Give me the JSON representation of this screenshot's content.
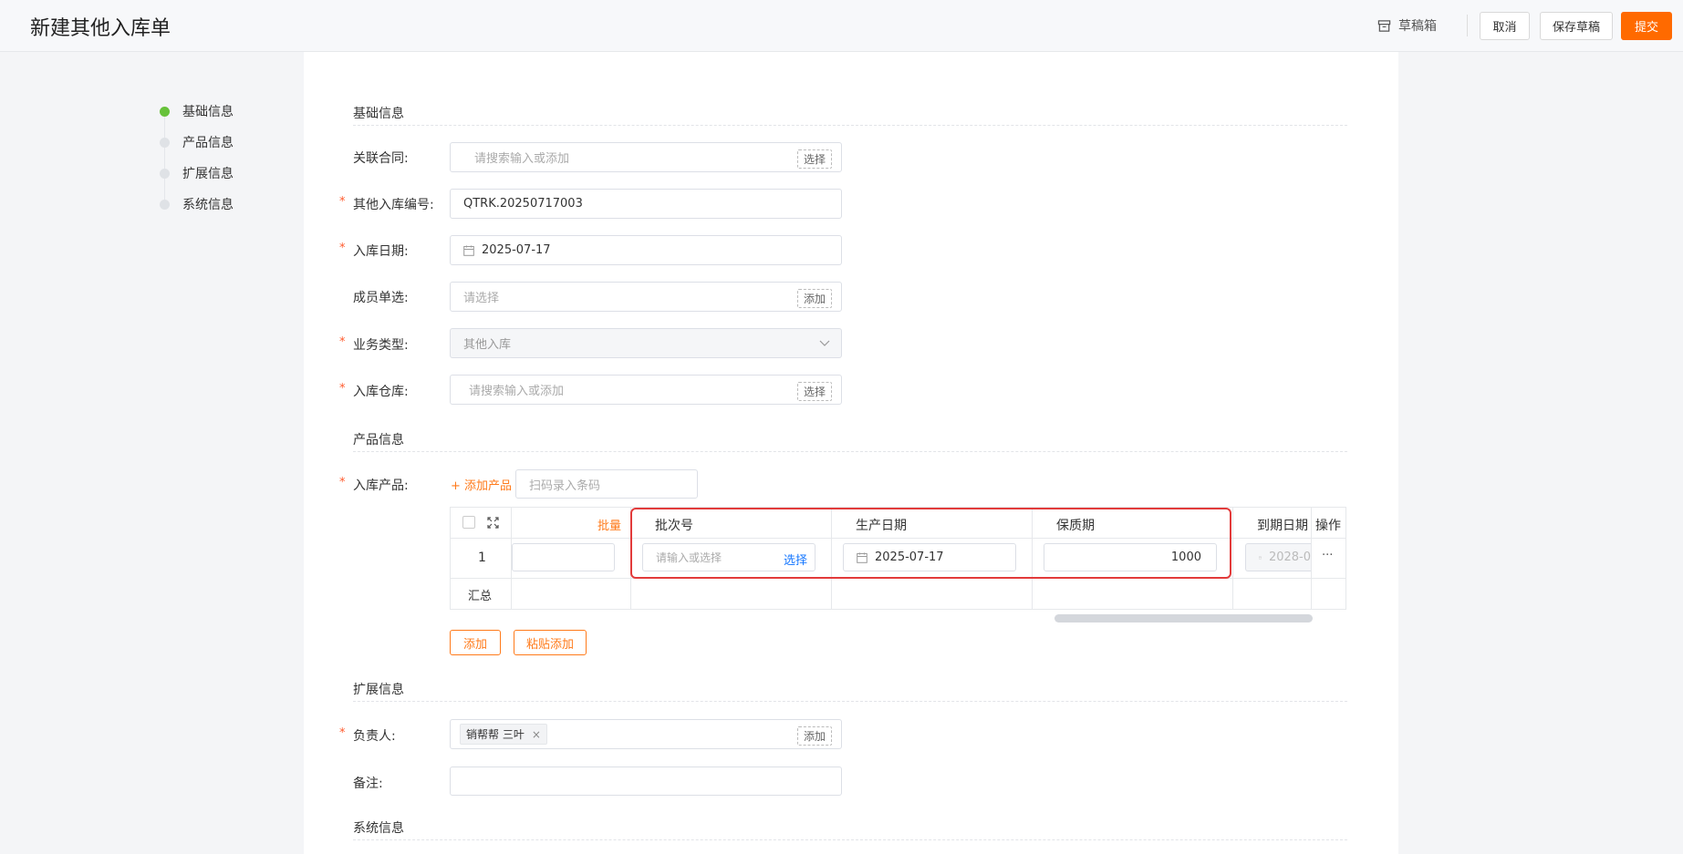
{
  "header": {
    "title": "新建其他入库单",
    "draft_label": "草稿箱",
    "cancel": "取消",
    "save_draft": "保存草稿",
    "submit": "提交"
  },
  "steps": [
    "基础信息",
    "产品信息",
    "扩展信息",
    "系统信息"
  ],
  "sections": {
    "basic": "基础信息",
    "product": "产品信息",
    "extend": "扩展信息",
    "system": "系统信息"
  },
  "form": {
    "contract": {
      "label": "关联合同:",
      "placeholder": "请搜索输入或添加",
      "action": "选择"
    },
    "code": {
      "label": "其他入库编号:",
      "value": "QTRK.20250717003"
    },
    "date": {
      "label": "入库日期:",
      "value": "2025-07-17"
    },
    "member": {
      "label": "成员单选:",
      "placeholder": "请选择",
      "action": "添加"
    },
    "biz_type": {
      "label": "业务类型:",
      "value": "其他入库"
    },
    "warehouse": {
      "label": "入库仓库:",
      "placeholder": "请搜索输入或添加",
      "action": "选择"
    },
    "products": {
      "label": "入库产品:",
      "add_link": "+ 添加产品",
      "scan_placeholder": "扫码录入条码"
    },
    "owner": {
      "label": "负责人:",
      "chip": "销帮帮 三叶",
      "action": "添加"
    },
    "remark": {
      "label": "备注:"
    }
  },
  "table": {
    "batch_header": "批量",
    "col_batch_no": "批次号",
    "col_prod_date": "生产日期",
    "col_shelf": "保质期",
    "col_expire": "到期日期",
    "col_action": "操作",
    "row_index": "1",
    "batch_placeholder": "请输入或选择",
    "batch_select": "选择",
    "prod_date": "2025-07-17",
    "shelf_life": "1000",
    "expire_date": "2028-0",
    "more": "···",
    "summary": "汇总"
  },
  "buttons": {
    "add": "添加",
    "paste_add": "粘贴添加"
  },
  "colors": {
    "accent": "#ff6a00",
    "step_active": "#67c23a",
    "highlight": "#e23b3b",
    "link_blue": "#1677ff"
  }
}
